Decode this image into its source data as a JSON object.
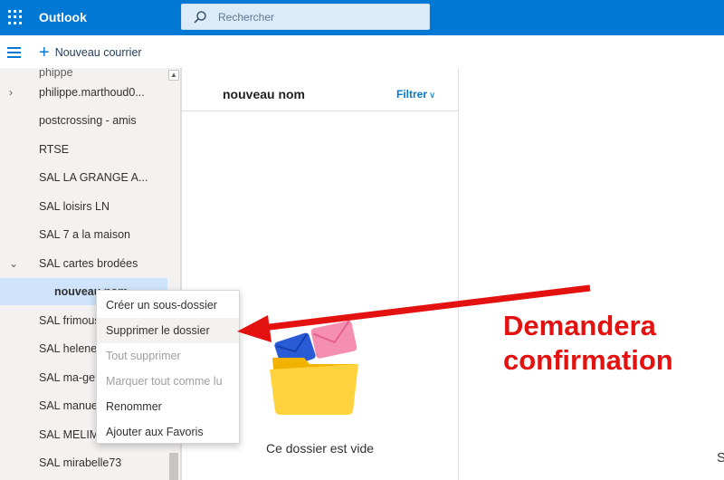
{
  "app": {
    "name": "Outlook",
    "accent": "#0078d4"
  },
  "search": {
    "placeholder": "Rechercher"
  },
  "commandbar": {
    "new_mail_label": "Nouveau courrier"
  },
  "sidebar": {
    "folders": [
      {
        "label": "philippe.marthoud0...",
        "expander": "collapsed"
      },
      {
        "label": "postcrossing - amis"
      },
      {
        "label": "RTSE"
      },
      {
        "label": "SAL LA GRANGE A..."
      },
      {
        "label": "SAL loisirs LN"
      },
      {
        "label": "SAL 7 a la maison"
      },
      {
        "label": "SAL cartes brodées",
        "expander": "expanded"
      },
      {
        "label": "nouveau nom",
        "selected": true
      },
      {
        "label": "SAL frimous"
      },
      {
        "label": "SAL helene c"
      },
      {
        "label": "SAL ma-ger"
      },
      {
        "label": "SAL manue"
      },
      {
        "label": "SAL MELIM"
      },
      {
        "label": "SAL mirabelle73"
      }
    ]
  },
  "message_list": {
    "title": "nouveau nom",
    "filter_label": "Filtrer",
    "empty_text": "Ce dossier est vide"
  },
  "reading_pane": {
    "partial_text": "S"
  },
  "context_menu": {
    "items": [
      {
        "label": "Créer un sous-dossier",
        "enabled": true
      },
      {
        "label": "Supprimer le dossier",
        "enabled": true,
        "hovered": true
      },
      {
        "label": "Tout supprimer",
        "enabled": false
      },
      {
        "label": "Marquer tout comme lu",
        "enabled": false
      },
      {
        "label": "Renommer",
        "enabled": true
      },
      {
        "label": "Ajouter aux Favoris",
        "enabled": true
      }
    ]
  },
  "annotation": {
    "line1": "Demandera",
    "line2": "confirmation",
    "color": "#e3110f"
  }
}
